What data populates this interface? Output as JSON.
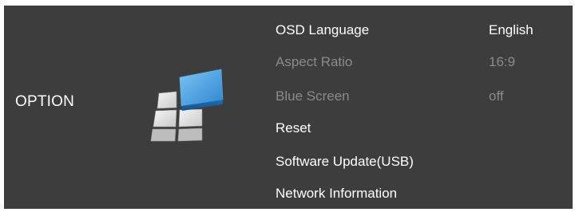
{
  "section": {
    "title": "OPTION",
    "icon": "option-tiles-icon"
  },
  "menu": {
    "items": [
      {
        "label": "OSD Language",
        "value": "English",
        "enabled": true
      },
      {
        "label": "Aspect Ratio",
        "value": "16:9",
        "enabled": false
      },
      {
        "label": "Blue Screen",
        "value": "off",
        "enabled": false
      },
      {
        "label": "Reset",
        "enabled": true
      },
      {
        "label": "Software Update(USB)",
        "enabled": true
      },
      {
        "label": "Network Information",
        "enabled": true
      }
    ]
  },
  "colors": {
    "background": "#3d3d3d",
    "text_enabled": "#ffffff",
    "text_disabled": "#8a8a8a",
    "accent_tile": "#3f95d8",
    "inactive_tile": "#e6e6e6"
  }
}
